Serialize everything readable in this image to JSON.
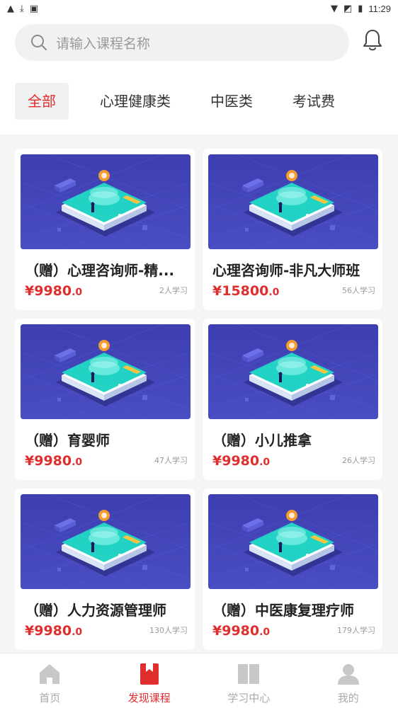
{
  "status_bar": {
    "time": "11:29",
    "left_icons": [
      "warning-icon",
      "download-icon",
      "image-icon"
    ],
    "right_icons": [
      "wifi-icon",
      "signal-off-icon",
      "battery-icon"
    ]
  },
  "search": {
    "placeholder": "请输入课程名称"
  },
  "tabs": [
    {
      "label": "全部",
      "active": true
    },
    {
      "label": "心理健康类",
      "active": false
    },
    {
      "label": "中医类",
      "active": false
    },
    {
      "label": "考试费",
      "active": false
    }
  ],
  "courses": [
    {
      "title": "（赠）心理咨询师-精...",
      "price": "¥9980",
      "price_decimal": ".0",
      "learners": "2人学习"
    },
    {
      "title": "心理咨询师-非凡大师班",
      "price": "¥15800",
      "price_decimal": ".0",
      "learners": "56人学习"
    },
    {
      "title": "（赠）育婴师",
      "price": "¥9980",
      "price_decimal": ".0",
      "learners": "47人学习"
    },
    {
      "title": "（赠）小儿推拿",
      "price": "¥9980",
      "price_decimal": ".0",
      "learners": "26人学习"
    },
    {
      "title": "（赠）人力资源管理师",
      "price": "¥9980",
      "price_decimal": ".0",
      "learners": "130人学习"
    },
    {
      "title": "（赠）中医康复理疗师",
      "price": "¥9980",
      "price_decimal": ".0",
      "learners": "179人学习"
    }
  ],
  "bottom_nav": [
    {
      "label": "首页",
      "icon": "home-icon",
      "active": false
    },
    {
      "label": "发现课程",
      "icon": "bookmark-book-icon",
      "active": true
    },
    {
      "label": "学习中心",
      "icon": "open-book-icon",
      "active": false
    },
    {
      "label": "我的",
      "icon": "user-icon",
      "active": false
    }
  ],
  "colors": {
    "accent": "#e02d2d",
    "card_image_bg": "#4547b8",
    "inactive_nav": "#c8c8c8"
  }
}
